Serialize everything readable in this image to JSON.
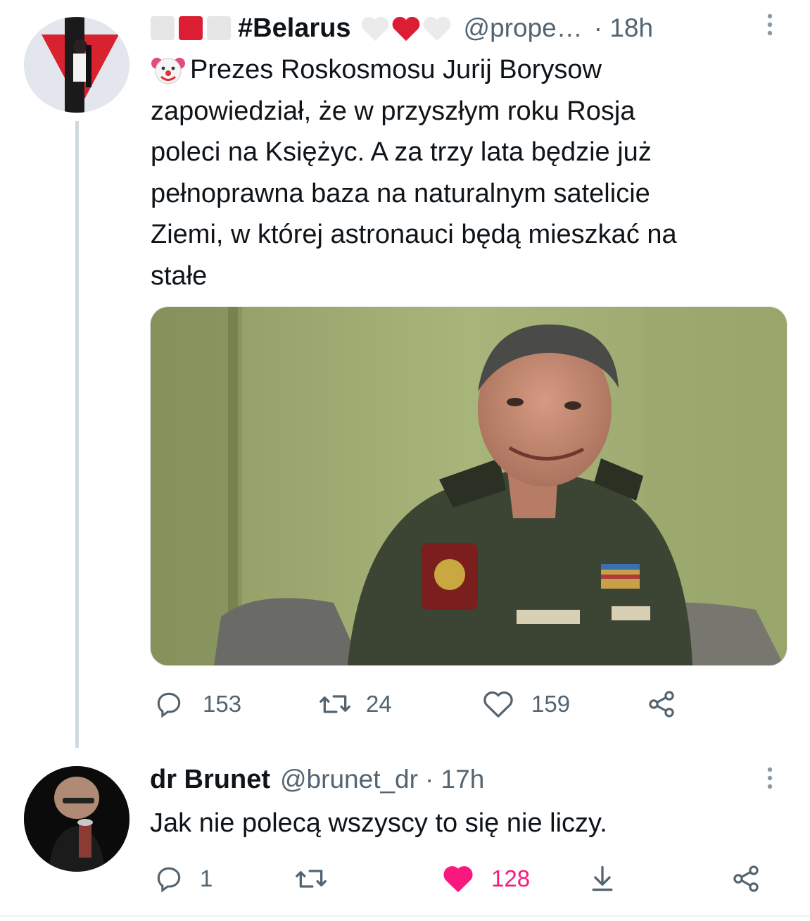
{
  "tweet1": {
    "author_boxes": [
      "#e6e6e6",
      "#dc1e35",
      "#e6e6e6"
    ],
    "author_name": "#Belarus",
    "author_hearts": [
      "#e6e6e6",
      "#dc1e35",
      "#e6e6e6"
    ],
    "handle": "@prope…",
    "time": "· 18h",
    "emoji": "clown-face",
    "text_lines": [
      "Prezes Roskosmosu Jurij Borysow",
      "zapowiedział, że w przyszłym roku Rosja",
      "poleci na Księżyc. A za trzy lata będzie już",
      "pełnoprawna baza na naturalnym satelicie",
      "Ziemi, w której astronauci będą mieszkać na",
      "stałe"
    ],
    "reply_count": "153",
    "retweet_count": "24",
    "like_count": "159"
  },
  "tweet2": {
    "author_name": "dr Brunet",
    "handle": "@brunet_dr",
    "time": "· 17h",
    "text": "Jak nie polecą wszyscy to się nie liczy.",
    "reply_count": "1",
    "like_count": "128",
    "like_color": "#f91880"
  },
  "colors": {
    "secondary_text": "#536471",
    "thread_line": "#cfd9de"
  }
}
